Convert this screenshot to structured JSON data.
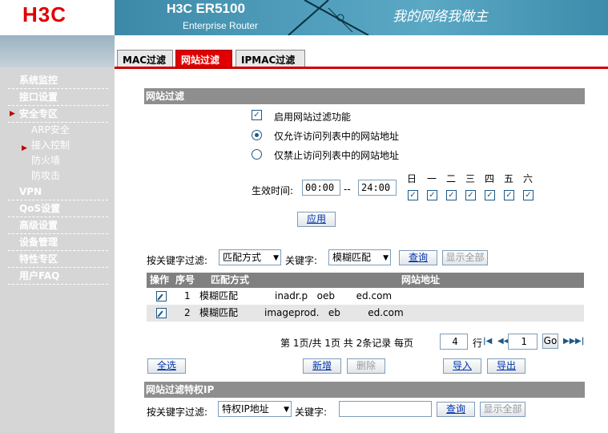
{
  "header": {
    "logo": "H3C",
    "product_prefix": "H3C",
    "product_model": "ER5100",
    "subtitle": "Enterprise Router",
    "slogan": "我的网络我做主"
  },
  "tabs": [
    {
      "label": "MAC过滤",
      "active": false
    },
    {
      "label": "网站过滤",
      "active": true
    },
    {
      "label": "IPMAC过滤",
      "active": false
    }
  ],
  "sidebar": {
    "items": [
      {
        "label": "系统监控"
      },
      {
        "label": "接口设置"
      },
      {
        "label": "安全专区"
      },
      {
        "label": "ARP安全"
      },
      {
        "label": "接入控制"
      },
      {
        "label": "防火墙"
      },
      {
        "label": "防攻击"
      },
      {
        "label": "VPN"
      },
      {
        "label": "QoS设置"
      },
      {
        "label": "高级设置"
      },
      {
        "label": "设备管理"
      },
      {
        "label": "特性专区"
      },
      {
        "label": "用户FAQ"
      }
    ]
  },
  "filter": {
    "section_title": "网站过滤",
    "enable_label": "启用网站过滤功能",
    "enable_checked": true,
    "allow_label": "仅允许访问列表中的网站地址",
    "deny_label": "仅禁止访问列表中的网站地址",
    "mode": "allow",
    "time_label": "生效时间:",
    "start_time": "00:00",
    "time_sep": "--",
    "end_time": "24:00",
    "days": [
      "日",
      "一",
      "二",
      "三",
      "四",
      "五",
      "六"
    ],
    "apply_label": "应用"
  },
  "search": {
    "keyword_filter_label": "按关键字过滤:",
    "match_select": "匹配方式",
    "keyword_label": "关键字:",
    "keyword_select": "模糊匹配",
    "query_label": "查询",
    "show_all_label": "显示全部"
  },
  "table": {
    "headers": [
      "操作",
      "序号",
      "匹配方式",
      "网站地址"
    ],
    "rows": [
      {
        "index": "1",
        "match": "模糊匹配",
        "url": "inadr.p   oeb       ed.com"
      },
      {
        "index": "2",
        "match": "模糊匹配",
        "url": "imageprod.   eb         ed.com"
      }
    ]
  },
  "pagination": {
    "text": "第 1页/共 1页 共 2条记录 每页",
    "per_page": "4",
    "row_label": "行",
    "page": "1",
    "go_label": "Go"
  },
  "actions": {
    "select_all": "全选",
    "add": "新增",
    "delete": "删除",
    "import": "导入",
    "export": "导出"
  },
  "privileged": {
    "section_title": "网站过滤特权IP",
    "keyword_filter_label": "按关键字过滤:",
    "select": "特权IP地址",
    "keyword_label": "关键字:",
    "keyword_value": "",
    "query_label": "查询",
    "show_all_label": "显示全部"
  }
}
